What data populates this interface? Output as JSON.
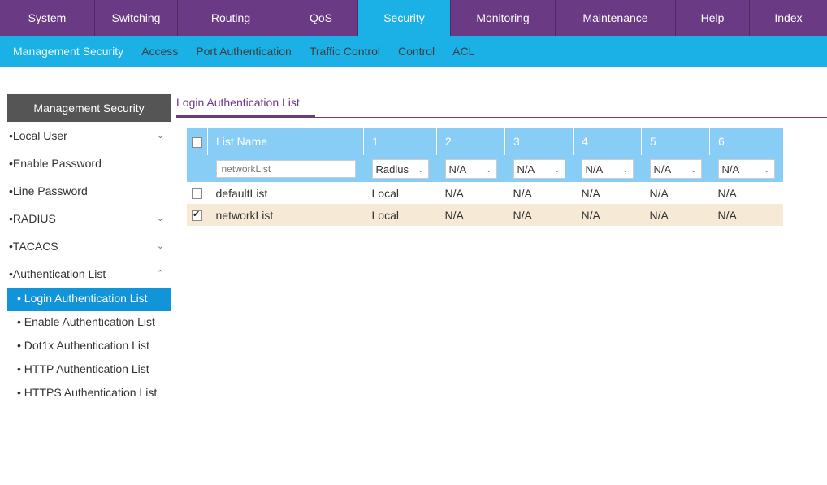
{
  "top_nav": [
    {
      "label": "System",
      "width": 117
    },
    {
      "label": "Switching",
      "width": 102
    },
    {
      "label": "Routing",
      "width": 131
    },
    {
      "label": "QoS",
      "width": 91
    },
    {
      "label": "Security",
      "width": 114,
      "active": true
    },
    {
      "label": "Monitoring",
      "width": 129
    },
    {
      "label": "Maintenance",
      "width": 148
    },
    {
      "label": "Help",
      "width": 91
    },
    {
      "label": "Index",
      "width": 95
    }
  ],
  "sub_nav": [
    "Management Security",
    "Access",
    "Port Authentication",
    "Traffic Control",
    "Control",
    "ACL"
  ],
  "sidebar": {
    "header": "Management Security",
    "items": [
      {
        "label": "•Local User",
        "chevron": "⌄"
      },
      {
        "label": "•Enable Password",
        "chevron": ""
      },
      {
        "label": "•Line Password",
        "chevron": ""
      },
      {
        "label": "•RADIUS",
        "chevron": "⌄"
      },
      {
        "label": "•TACACS",
        "chevron": "⌄"
      },
      {
        "label": "•Authentication List",
        "chevron": "⌃"
      }
    ],
    "subitems": [
      "• Login Authentication List",
      "• Enable Authentication List",
      "• Dot1x Authentication List",
      "• HTTP Authentication List",
      "• HTTPS Authentication List"
    ]
  },
  "content": {
    "tab_label": "Login Authentication List",
    "table": {
      "headers": [
        "List Name",
        "1",
        "2",
        "3",
        "4",
        "5",
        "6"
      ],
      "edit_row": {
        "name_placeholder": "networkList",
        "selects": [
          "Radius",
          "N/A",
          "N/A",
          "N/A",
          "N/A",
          "N/A"
        ]
      },
      "rows": [
        {
          "checked": false,
          "cells": [
            "defaultList",
            "Local",
            "N/A",
            "N/A",
            "N/A",
            "N/A",
            "N/A"
          ]
        },
        {
          "checked": true,
          "cells": [
            "networkList",
            "Local",
            "N/A",
            "N/A",
            "N/A",
            "N/A",
            "N/A"
          ]
        }
      ]
    }
  }
}
